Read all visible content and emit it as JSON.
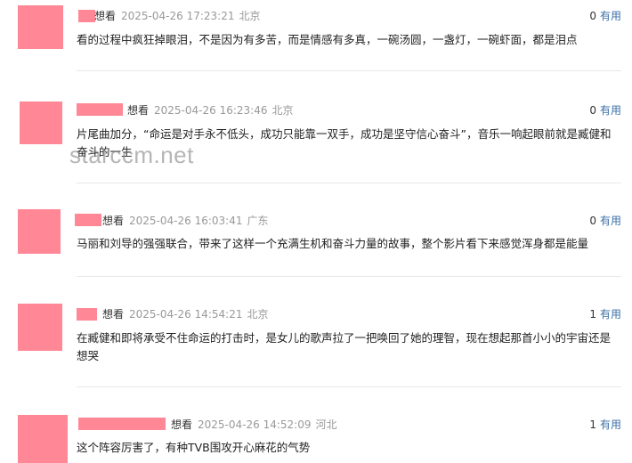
{
  "comments": [
    {
      "status": "想看",
      "time": "2025-04-26 17:23:21",
      "location": "北京",
      "likes": "0",
      "useful_label": "有用",
      "text": "看的过程中疯狂掉眼泪，不是因为有多苦，而是情感有多真，一碗汤圆，一盏灯，一碗虾面，都是泪点"
    },
    {
      "status": "想看",
      "time": "2025-04-26 16:23:46",
      "location": "北京",
      "likes": "0",
      "useful_label": "有用",
      "text": "片尾曲加分，“命运是对手永不低头，成功只能靠一双手，成功是坚守信心奋斗”，音乐一响起眼前就是臧健和奋斗的一生"
    },
    {
      "status": "想看",
      "time": "2025-04-26 16:03:41",
      "location": "广东",
      "likes": "0",
      "useful_label": "有用",
      "text": "马丽和刘导的强强联合，带来了这样一个充满生机和奋斗力量的故事，整个影片看下来感觉浑身都是能量"
    },
    {
      "status": "想看",
      "time": "2025-04-26 14:54:21",
      "location": "北京",
      "likes": "1",
      "useful_label": "有用",
      "text": "在臧健和即将承受不住命运的打击时，是女儿的歌声拉了一把唤回了她的理智，现在想起那首小小的宇宙还是想哭"
    },
    {
      "status": "想看",
      "time": "2025-04-26 14:52:09",
      "location": "河北",
      "likes": "1",
      "useful_label": "有用",
      "text": "这个阵容厉害了，有种TVB围攻开心麻花的气势"
    }
  ],
  "watermark": "starccm.net",
  "colors": {
    "redaction": "#ff8796",
    "link": "#3b6fa6",
    "meta": "#999999",
    "divider": "#e8e8e8"
  }
}
